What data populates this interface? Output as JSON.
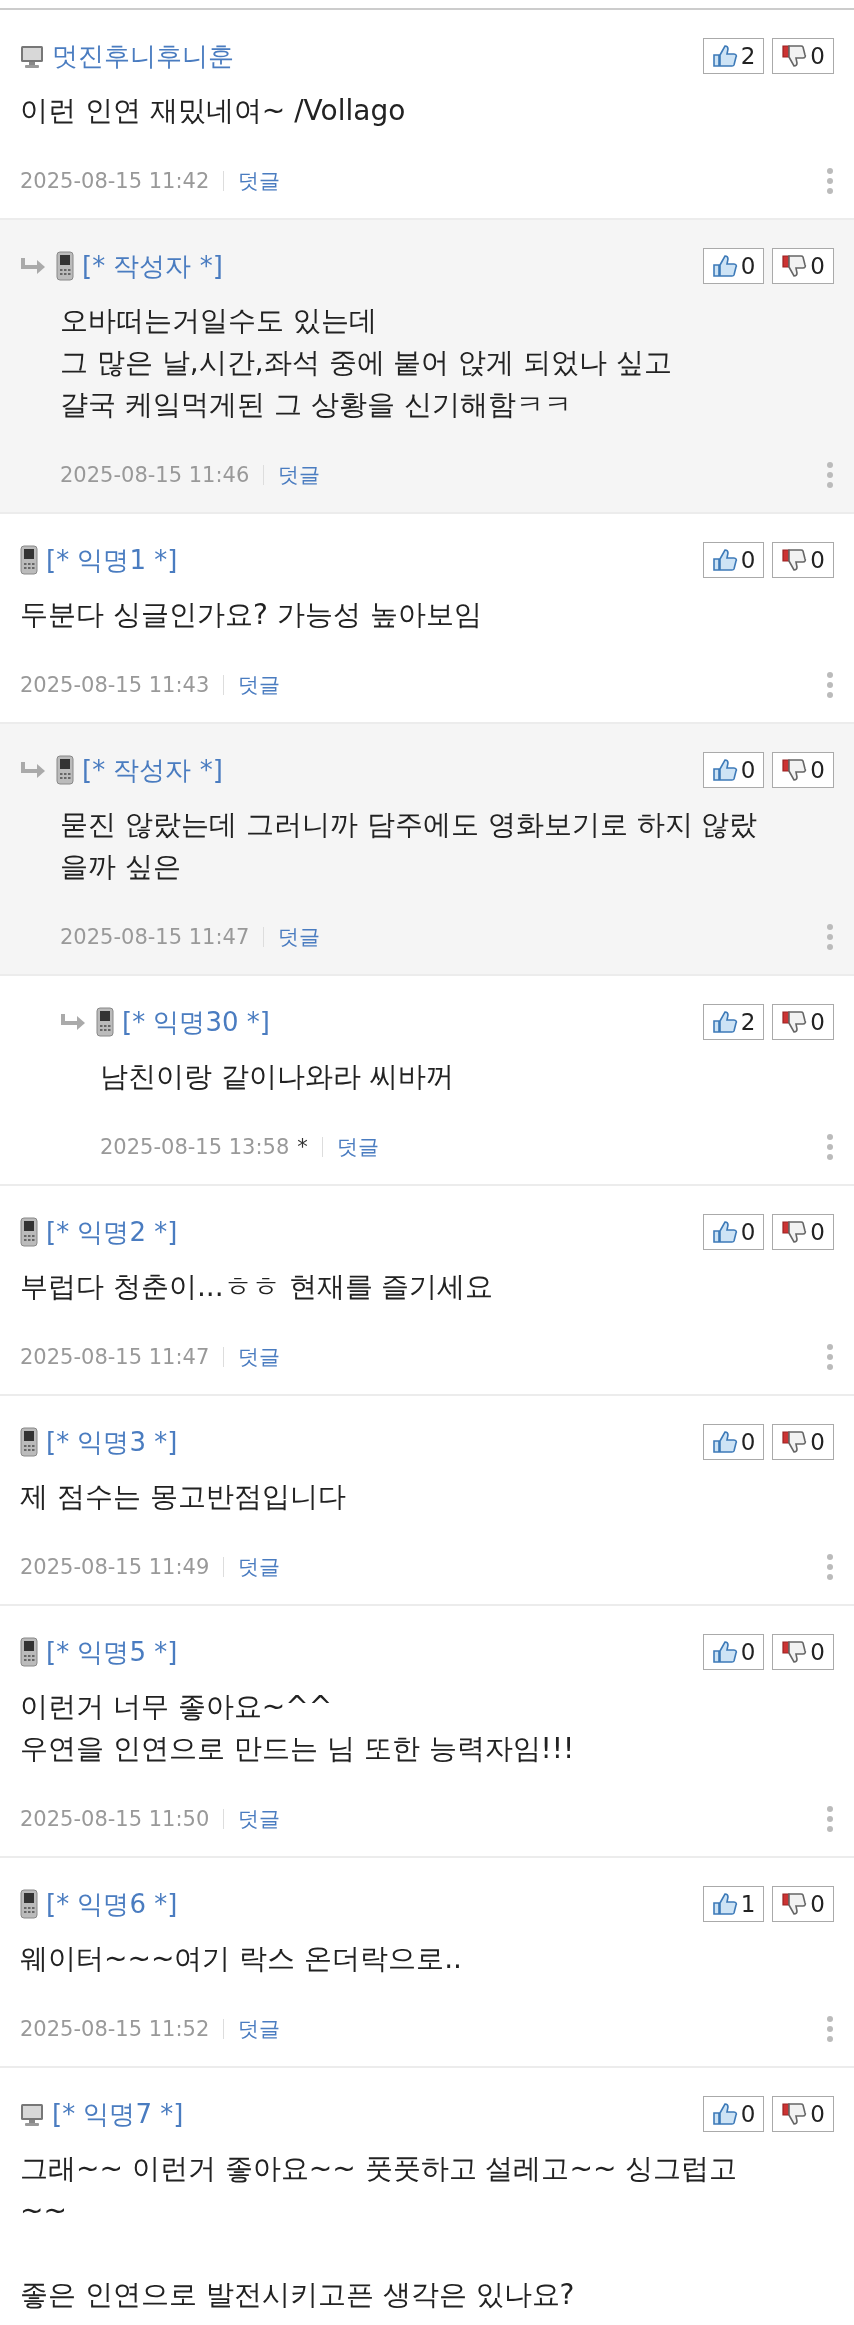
{
  "comments": [
    {
      "kind": "pc",
      "author": "멋진후니후니훈",
      "likes": "2",
      "dislikes": "0",
      "body": "이런 인연 재밌네여~ /Vollago",
      "date": "2025-08-15 11:42",
      "reply_label": "덧글",
      "children": [
        {
          "kind": "mobile",
          "author": "[* 작성자 *]",
          "likes": "0",
          "dislikes": "0",
          "body": "오바떠는거일수도 있는데\n그 많은 날,시간,좌석 중에 붙어 앉게 되었나 싶고\n걀국 케잌먹게된 그 상황을 신기해함ㅋㅋ",
          "date": "2025-08-15 11:46",
          "reply_label": "덧글"
        }
      ]
    },
    {
      "kind": "mobile",
      "author": "[* 익명1 *]",
      "likes": "0",
      "dislikes": "0",
      "body": "두분다 싱글인가요? 가능성 높아보임",
      "date": "2025-08-15 11:43",
      "reply_label": "덧글",
      "children": [
        {
          "kind": "mobile",
          "author": "[* 작성자 *]",
          "likes": "0",
          "dislikes": "0",
          "body": "묻진 않랐는데 그러니까 담주에도 영화보기로 하지 않랐을까 싶은",
          "date": "2025-08-15 11:47",
          "reply_label": "덧글",
          "children": [
            {
              "kind": "mobile",
              "author": "[* 익명30 *]",
              "likes": "2",
              "dislikes": "0",
              "body": "남친이랑 같이나와라 씨바꺼",
              "date": "2025-08-15 13:58",
              "edited_mark": "*",
              "reply_label": "덧글"
            }
          ]
        }
      ]
    },
    {
      "kind": "mobile",
      "author": "[* 익명2 *]",
      "likes": "0",
      "dislikes": "0",
      "body": "부럽다 청춘이...ㅎㅎ 현재를 즐기세요",
      "date": "2025-08-15 11:47",
      "reply_label": "덧글"
    },
    {
      "kind": "mobile",
      "author": "[* 익명3 *]",
      "likes": "0",
      "dislikes": "0",
      "body": "제 점수는 몽고반점입니다",
      "date": "2025-08-15 11:49",
      "reply_label": "덧글"
    },
    {
      "kind": "mobile",
      "author": "[* 익명5 *]",
      "likes": "0",
      "dislikes": "0",
      "body": "이런거 너무 좋아요~^^\n우연을 인연으로 만드는 님 또한 능력자임!!!",
      "date": "2025-08-15 11:50",
      "reply_label": "덧글"
    },
    {
      "kind": "mobile",
      "author": "[* 익명6 *]",
      "likes": "1",
      "dislikes": "0",
      "body": "웨이터~~~여기 락스 온더락으로..",
      "date": "2025-08-15 11:52",
      "reply_label": "덧글"
    },
    {
      "kind": "pc",
      "author": "[* 익명7 *]",
      "likes": "0",
      "dislikes": "0",
      "body": "그래~~ 이런거 좋아요~~ 풋풋하고 설레고~~ 싱그럽고~~\n\n좋은 인연으로 발전시키고픈 생각은 있나요?"
    }
  ]
}
